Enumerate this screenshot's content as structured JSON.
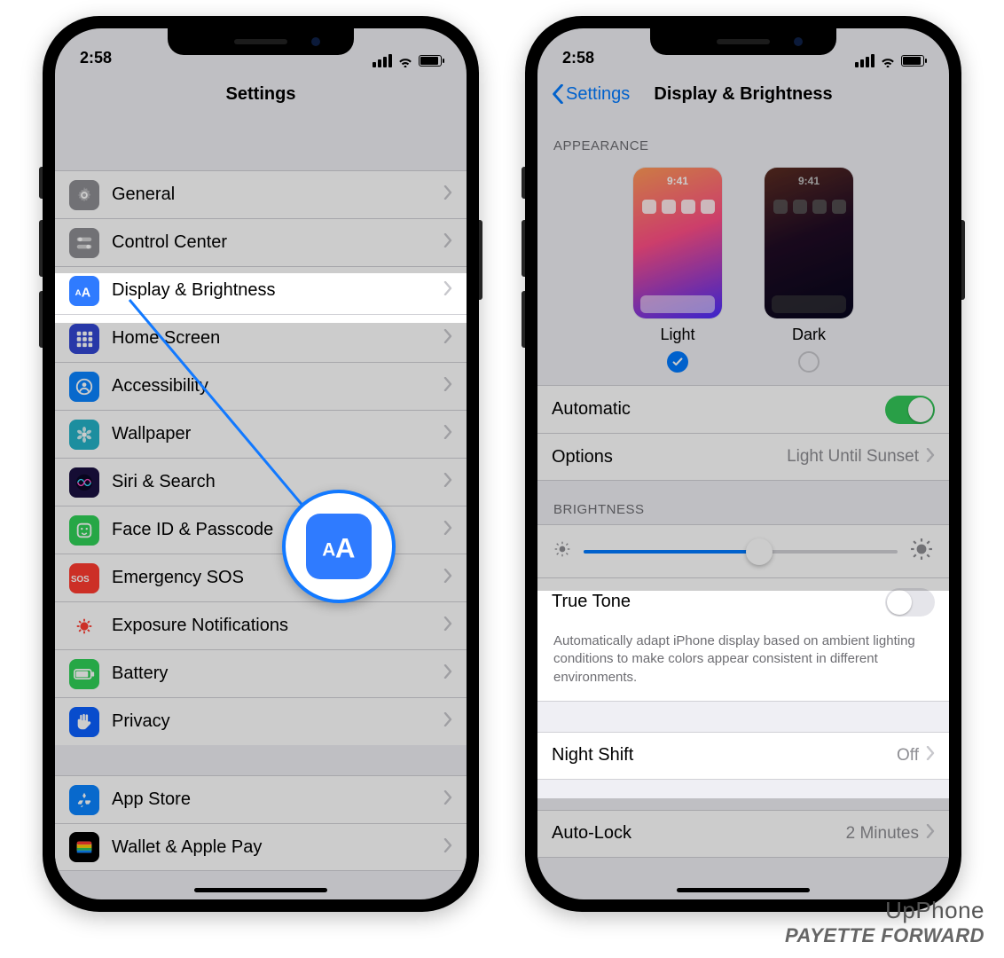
{
  "status": {
    "time": "2:58"
  },
  "left": {
    "title": "Settings",
    "items": [
      {
        "key": "general",
        "label": "General",
        "bg": "#8e8e93",
        "glyph": "gear"
      },
      {
        "key": "controlcenter",
        "label": "Control Center",
        "bg": "#8e8e93",
        "glyph": "switches"
      },
      {
        "key": "display",
        "label": "Display & Brightness",
        "bg": "#2f7bff",
        "glyph": "AA",
        "highlight": true
      },
      {
        "key": "homescreen",
        "label": "Home Screen",
        "bg": "#3246d3",
        "glyph": "grid"
      },
      {
        "key": "accessibility",
        "label": "Accessibility",
        "bg": "#0a84ff",
        "glyph": "person"
      },
      {
        "key": "wallpaper",
        "label": "Wallpaper",
        "bg": "#23b2c7",
        "glyph": "flower"
      },
      {
        "key": "siri",
        "label": "Siri & Search",
        "bg": "#1b1141",
        "glyph": "siri"
      },
      {
        "key": "faceid",
        "label": "Face ID & Passcode",
        "bg": "#30d158",
        "glyph": "face"
      },
      {
        "key": "sos",
        "label": "Emergency SOS",
        "bg": "#ff3b30",
        "glyph": "sos"
      },
      {
        "key": "exposure",
        "label": "Exposure Notifications",
        "bg": "#ffffff",
        "glyph": "covid",
        "fg": "#ff3b30"
      },
      {
        "key": "battery",
        "label": "Battery",
        "bg": "#30d158",
        "glyph": "batt"
      },
      {
        "key": "privacy",
        "label": "Privacy",
        "bg": "#0a60ff",
        "glyph": "hand"
      }
    ],
    "items2": [
      {
        "key": "appstore",
        "label": "App Store",
        "bg": "#0a84ff",
        "glyph": "appstore"
      },
      {
        "key": "wallet",
        "label": "Wallet & Apple Pay",
        "bg": "#000000",
        "glyph": "wallet"
      }
    ]
  },
  "right": {
    "back": "Settings",
    "title": "Display & Brightness",
    "appearance_header": "APPEARANCE",
    "appearance": {
      "preview_time": "9:41",
      "light_label": "Light",
      "dark_label": "Dark",
      "selected": "light"
    },
    "automatic": {
      "label": "Automatic",
      "on": true
    },
    "options": {
      "label": "Options",
      "value": "Light Until Sunset"
    },
    "brightness_header": "BRIGHTNESS",
    "brightness": {
      "percent": 56
    },
    "truetone": {
      "label": "True Tone",
      "on": false,
      "note": "Automatically adapt iPhone display based on ambient lighting conditions to make colors appear consistent in different environments."
    },
    "nightshift": {
      "label": "Night Shift",
      "value": "Off"
    },
    "autolock": {
      "label": "Auto-Lock",
      "value": "2 Minutes"
    }
  },
  "watermark": {
    "line1": "UpPhone",
    "line2": "PAYETTE FORWARD"
  }
}
